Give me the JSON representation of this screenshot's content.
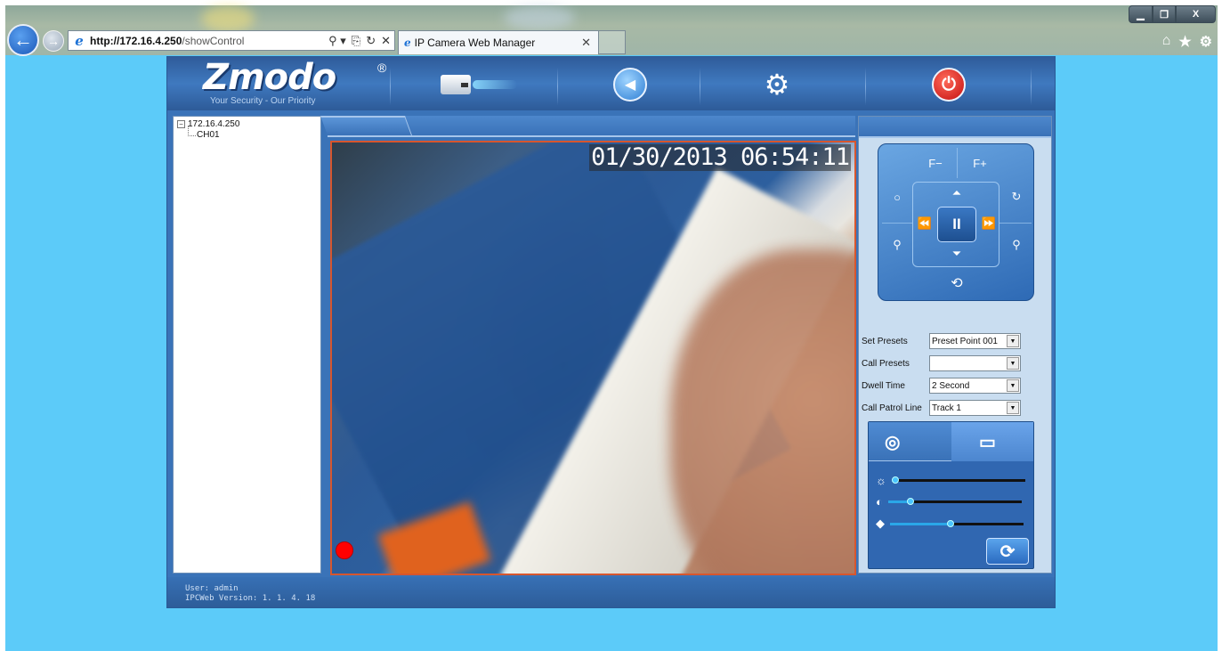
{
  "browser": {
    "url_host": "http://172.16.4.250",
    "url_path": "/showControl",
    "address_controls": [
      "⚲ ▾",
      "⎘",
      "↻",
      "✕"
    ],
    "tab_title": "IP Camera Web Manager",
    "tab_close": "✕",
    "window_controls": {
      "minimize": "▁",
      "maximize": "❐",
      "close": "X"
    },
    "tools": {
      "home": "⌂",
      "favorites": "★",
      "settings": "⚙"
    }
  },
  "app": {
    "logo_text": "Zmodo",
    "logo_reg": "®",
    "logo_tagline": "Your Security - Our Priority",
    "header_icons": [
      "camera-icon",
      "back-icon",
      "settings-icon",
      "power-icon"
    ],
    "back_glyph": "◀",
    "settings_glyph": "⚙",
    "power_glyph": "⏻",
    "tree": {
      "expander": "−",
      "root": "172.16.4.250",
      "children": [
        "CH01"
      ]
    },
    "video": {
      "timestamp": "01/30/2013 06:54:11",
      "recording": true
    },
    "ptz": {
      "focus_minus": "F−",
      "focus_plus": "F+",
      "iris_left": "○",
      "iris_right": "↻",
      "zoom_out": "🔍︎−",
      "zoom_out_glyph": "⚲",
      "zoom_in_glyph": "⚲",
      "up": "⏶",
      "down": "⏷",
      "left": "⏪",
      "right": "⏩",
      "pause": "II",
      "loop": "⟲"
    },
    "presets": {
      "set_presets_label": "Set Presets",
      "set_presets_value": "Preset Point 001",
      "call_presets_label": "Call Presets",
      "call_presets_value": "",
      "dwell_time_label": "Dwell Time",
      "dwell_time_value": "2 Second",
      "call_patrol_label": "Call Patrol Line",
      "call_patrol_value": "Track 1"
    },
    "image_settings": {
      "brightness": 0.03,
      "contrast": 0.17,
      "saturation": 0.45,
      "brightness_icon": "☼",
      "contrast_icon": "◐",
      "saturation_icon": "◆",
      "refresh_glyph": "⟳"
    },
    "footer": {
      "user": "User: admin",
      "version": "IPCWeb Version: 1. 1. 4. 18"
    }
  }
}
